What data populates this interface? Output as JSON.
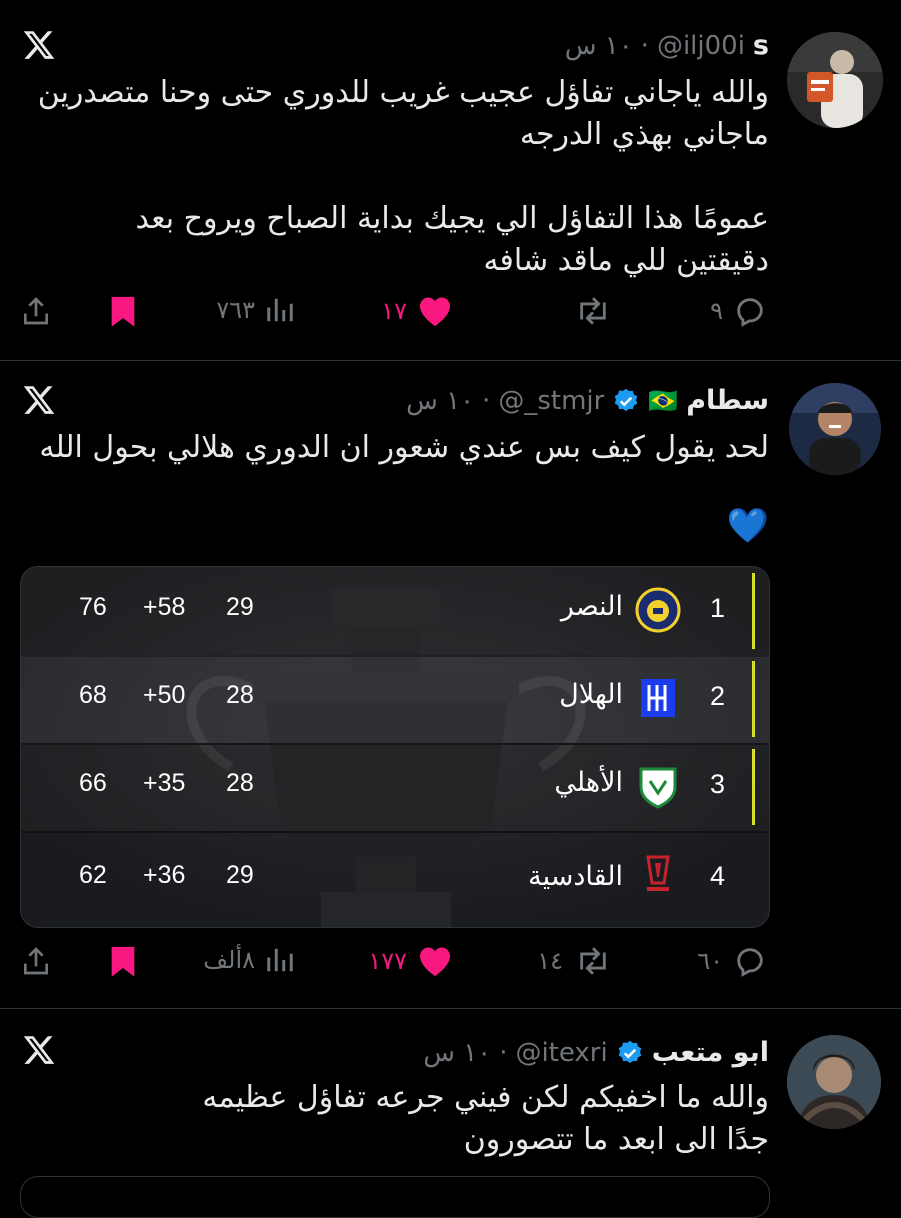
{
  "tweets": [
    {
      "name": "s",
      "handle": "@ilj00i",
      "time": "١٠ س",
      "body": "والله ياجاني تفاؤل عجيب غريب للدوري حتى وحنا متصدرين\nماجاني بهذي الدرجه\n\nعمومًا هذا التفاؤل الي يجيك بداية الصباح ويروح بعد\nدقيقتين للي ماقد شافه",
      "replies": "٩",
      "reposts": "",
      "likes": "١٧",
      "views": "٧٦٣"
    },
    {
      "name": "سطام",
      "flag": "🇧🇷",
      "handle": "@_stmjr",
      "time": "١٠ س",
      "body": "لحد يقول كيف بس عندي شعور ان الدوري هلالي بحول الله",
      "emoji": "💙",
      "replies": "٦٠",
      "reposts": "١٤",
      "likes": "١٧٧",
      "views": "٨ألف"
    },
    {
      "name": "ابو متعب",
      "handle": "@itexri",
      "time": "١٠ س",
      "body": "والله ما اخفيكم لكن فيني جرعه تفاؤل عظيمه\nجدًا الى ابعد ما تتصورون"
    }
  ],
  "table": {
    "rows": [
      {
        "pos": "1",
        "team": "النصر",
        "played": "29",
        "gd": "+58",
        "pts": "76"
      },
      {
        "pos": "2",
        "team": "الهلال",
        "played": "28",
        "gd": "+50",
        "pts": "68"
      },
      {
        "pos": "3",
        "team": "الأهلي",
        "played": "28",
        "gd": "+35",
        "pts": "66"
      },
      {
        "pos": "4",
        "team": "القادسية",
        "played": "29",
        "gd": "+36",
        "pts": "62"
      }
    ]
  },
  "colors": {
    "background": "#000000",
    "text": "#e7e9ea",
    "muted": "#71767b",
    "like_pink": "#f91880",
    "verified_blue": "#1d9bf0",
    "table_highlight": "#d6e02a"
  }
}
